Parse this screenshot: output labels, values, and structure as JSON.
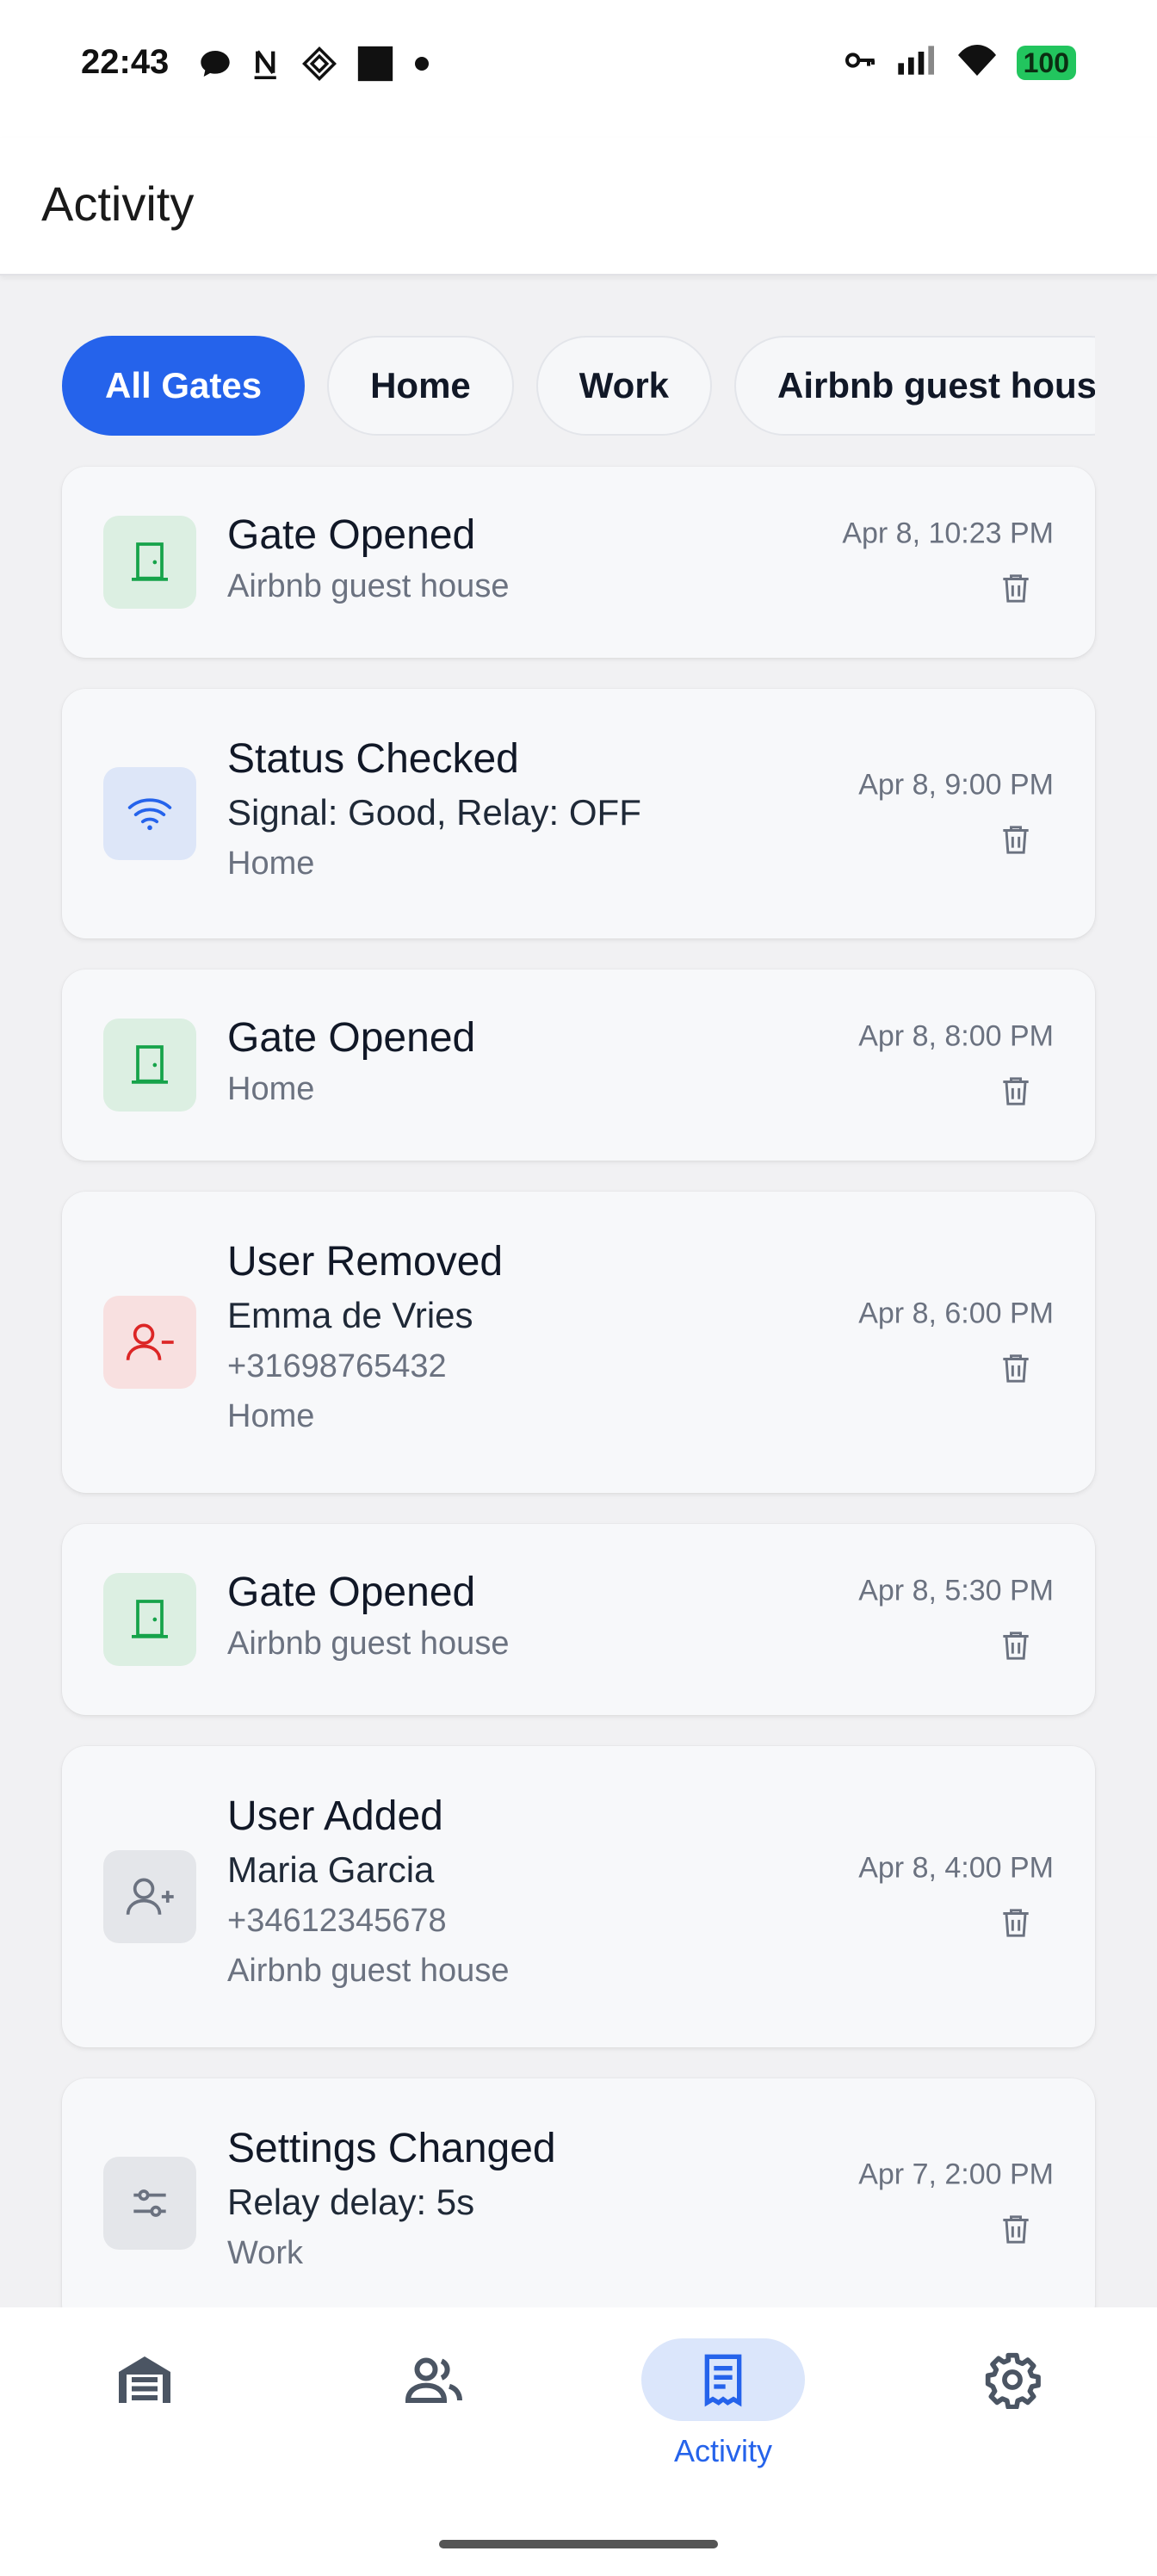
{
  "status_bar": {
    "time": "22:43",
    "notification_icons": [
      "chat-bubble-icon",
      "n-app-icon",
      "diamond-app-icon",
      "black-square-icon",
      "dot-icon"
    ],
    "system_icons": [
      "vpn-key-icon",
      "signal-icon",
      "wifi-icon"
    ],
    "battery": "100"
  },
  "app_bar": {
    "title": "Activity"
  },
  "filters": {
    "chips": [
      {
        "label": "All Gates",
        "active": true
      },
      {
        "label": "Home",
        "active": false
      },
      {
        "label": "Work",
        "active": false
      },
      {
        "label": "Airbnb guest hous",
        "active": false
      }
    ]
  },
  "activities": [
    {
      "title": "Gate Opened",
      "details": [],
      "gate": "Airbnb guest house",
      "time": "Apr 8, 10:23 PM",
      "icon": "door-icon",
      "icon_color": "#16a34a"
    },
    {
      "title": "Status Checked",
      "details": [
        "Signal: Good, Relay: OFF"
      ],
      "gate": "Home",
      "time": "Apr 8, 9:00 PM",
      "icon": "wifi-icon",
      "icon_color": "#2563eb"
    },
    {
      "title": "Gate Opened",
      "details": [],
      "gate": "Home",
      "time": "Apr 8, 8:00 PM",
      "icon": "door-icon",
      "icon_color": "#16a34a"
    },
    {
      "title": "User Removed",
      "details": [
        "Emma de Vries",
        "+31698765432"
      ],
      "gate": "Home",
      "time": "Apr 8, 6:00 PM",
      "icon": "user-minus-icon",
      "icon_color": "#dc2626"
    },
    {
      "title": "Gate Opened",
      "details": [],
      "gate": "Airbnb guest house",
      "time": "Apr 8, 5:30 PM",
      "icon": "door-icon",
      "icon_color": "#16a34a"
    },
    {
      "title": "User Added",
      "details": [
        "Maria Garcia",
        "+34612345678"
      ],
      "gate": "Airbnb guest house",
      "time": "Apr 8, 4:00 PM",
      "icon": "user-plus-icon",
      "icon_color": "#6b7280"
    },
    {
      "title": "Settings Changed",
      "details": [
        "Relay delay: 5s"
      ],
      "gate": "Work",
      "time": "Apr 7, 2:00 PM",
      "icon": "sliders-icon",
      "icon_color": "#6b7280"
    }
  ],
  "bottom_nav": {
    "items": [
      {
        "icon": "garage-icon",
        "label": "",
        "active": false
      },
      {
        "icon": "users-icon",
        "label": "",
        "active": false
      },
      {
        "icon": "activity-receipt-icon",
        "label": "Activity",
        "active": true
      },
      {
        "icon": "gear-icon",
        "label": "",
        "active": false
      }
    ]
  },
  "colors": {
    "accent": "#2563eb",
    "gate_opened": "#16a34a",
    "user_removed": "#dc2626",
    "neutral": "#6b7280"
  }
}
